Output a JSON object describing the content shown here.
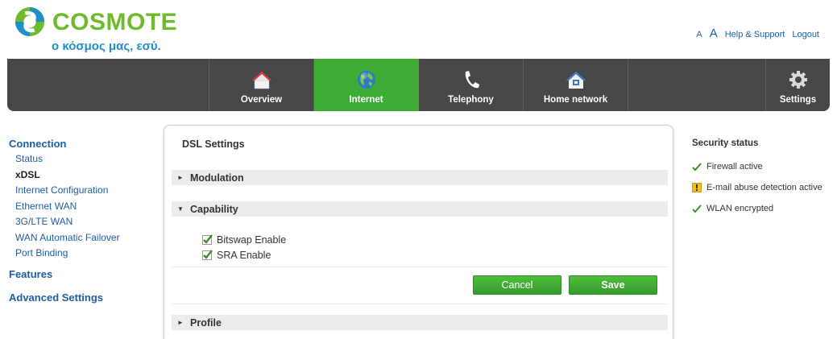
{
  "brand": {
    "name": "COSMOTE",
    "tagline": "ο κόσμος μας, εσύ.",
    "logo_colors": [
      "#6fba2c",
      "#1f8fc8"
    ]
  },
  "toplinks": {
    "font_small": "A",
    "font_large": "A",
    "help": "Help & Support",
    "logout": "Logout"
  },
  "nav": {
    "items": [
      {
        "label": "Overview",
        "icon": "home-icon"
      },
      {
        "label": "Internet",
        "icon": "globe-icon",
        "active": true
      },
      {
        "label": "Telephony",
        "icon": "phone-icon"
      },
      {
        "label": "Home network",
        "icon": "home-network-icon"
      }
    ],
    "settings": {
      "label": "Settings",
      "icon": "gear-icon"
    },
    "accent": "#3eab34",
    "bar_color": "#474747"
  },
  "sidebar": {
    "connection": "Connection",
    "items": [
      {
        "label": "Status"
      },
      {
        "label": "xDSL",
        "current": true
      },
      {
        "label": "Internet Configuration"
      },
      {
        "label": "Ethernet WAN"
      },
      {
        "label": "3G/LTE WAN"
      },
      {
        "label": "WAN Automatic Failover"
      },
      {
        "label": "Port Binding"
      }
    ],
    "features": "Features",
    "advanced": "Advanced Settings"
  },
  "panel": {
    "title": "DSL Settings",
    "sections": {
      "modulation": {
        "label": "Modulation",
        "expanded": false
      },
      "capability": {
        "label": "Capability",
        "expanded": true
      },
      "profile": {
        "label": "Profile",
        "expanded": false
      }
    },
    "checkboxes": [
      {
        "label": "Bitswap Enable",
        "checked": true
      },
      {
        "label": "SRA Enable",
        "checked": true
      }
    ],
    "cancel_label": "Cancel",
    "save_label": "Save"
  },
  "security": {
    "title": "Security status",
    "items": [
      {
        "label": "Firewall active",
        "icon": "check-icon",
        "status": "ok"
      },
      {
        "label": "E-mail abuse detection active",
        "icon": "warning-icon",
        "status": "warning"
      },
      {
        "label": "WLAN encrypted",
        "icon": "check-icon",
        "status": "ok"
      }
    ]
  }
}
